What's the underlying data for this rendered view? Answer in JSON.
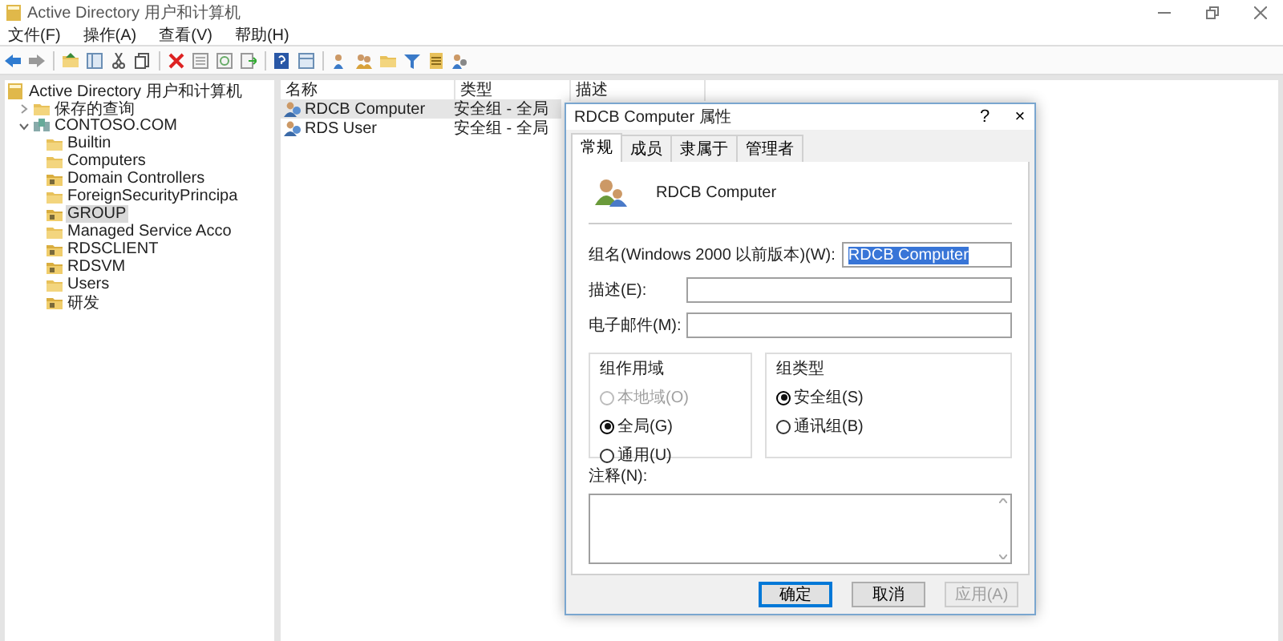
{
  "window": {
    "title": "Active Directory 用户和计算机"
  },
  "menu": [
    "文件(F)",
    "操作(A)",
    "查看(V)",
    "帮助(H)"
  ],
  "tree": [
    {
      "label": "Active Directory 用户和计算机",
      "kind": "console",
      "selected": false,
      "children": [
        {
          "label": "保存的查询",
          "kind": "folder",
          "selected": false,
          "expanded": false
        },
        {
          "label": "CONTOSO.COM",
          "kind": "domain",
          "selected": false,
          "expanded": true,
          "children": [
            {
              "label": "Builtin",
              "kind": "folder",
              "selected": false
            },
            {
              "label": "Computers",
              "kind": "folder",
              "selected": false
            },
            {
              "label": "Domain Controllers",
              "kind": "ou",
              "selected": false
            },
            {
              "label": "ForeignSecurityPrincipa",
              "kind": "folder",
              "selected": false
            },
            {
              "label": "GROUP",
              "kind": "ou",
              "selected": true
            },
            {
              "label": "Managed Service Acco",
              "kind": "folder",
              "selected": false
            },
            {
              "label": "RDSCLIENT",
              "kind": "ou",
              "selected": false
            },
            {
              "label": "RDSVM",
              "kind": "ou",
              "selected": false
            },
            {
              "label": "Users",
              "kind": "folder",
              "selected": false
            },
            {
              "label": "研发",
              "kind": "ou",
              "selected": false
            }
          ]
        }
      ]
    }
  ],
  "list": {
    "columns": [
      "名称",
      "类型",
      "描述"
    ],
    "rows": [
      {
        "name": "RDCB Computer",
        "type": "安全组 - 全局",
        "selected": true
      },
      {
        "name": "RDS User",
        "type": "安全组 - 全局",
        "selected": false
      }
    ]
  },
  "dialog": {
    "title": "RDCB Computer 属性",
    "help": "?",
    "close": "×",
    "tabs": [
      {
        "label": "常规",
        "selected": true
      },
      {
        "label": "成员",
        "selected": false
      },
      {
        "label": "隶属于",
        "selected": false
      },
      {
        "label": "管理者",
        "selected": false
      }
    ],
    "object_name": "RDCB Computer",
    "fields": [
      {
        "label": "组名(Windows 2000 以前版本)(W):",
        "value": "RDCB Computer",
        "highlighted": true
      },
      {
        "label": "描述(E):"
      },
      {
        "label": "电子邮件(M):"
      }
    ],
    "groups": [
      {
        "title": "组作用域",
        "options": [
          {
            "label": "本地域(O)",
            "selected": false,
            "disabled": true
          },
          {
            "label": "全局(G)",
            "selected": true,
            "disabled": false
          },
          {
            "label": "通用(U)",
            "selected": false,
            "disabled": false
          }
        ]
      },
      {
        "title": "组类型",
        "options": [
          {
            "label": "安全组(S)",
            "selected": true,
            "disabled": false
          },
          {
            "label": "通讯组(B)",
            "selected": false,
            "disabled": false
          }
        ]
      }
    ],
    "notes_label": "注释(N):",
    "buttons": [
      {
        "label": "确定",
        "default": true,
        "disabled": false
      },
      {
        "label": "取消",
        "default": false,
        "disabled": false
      },
      {
        "label": "应用(A)",
        "default": false,
        "disabled": true
      }
    ]
  }
}
